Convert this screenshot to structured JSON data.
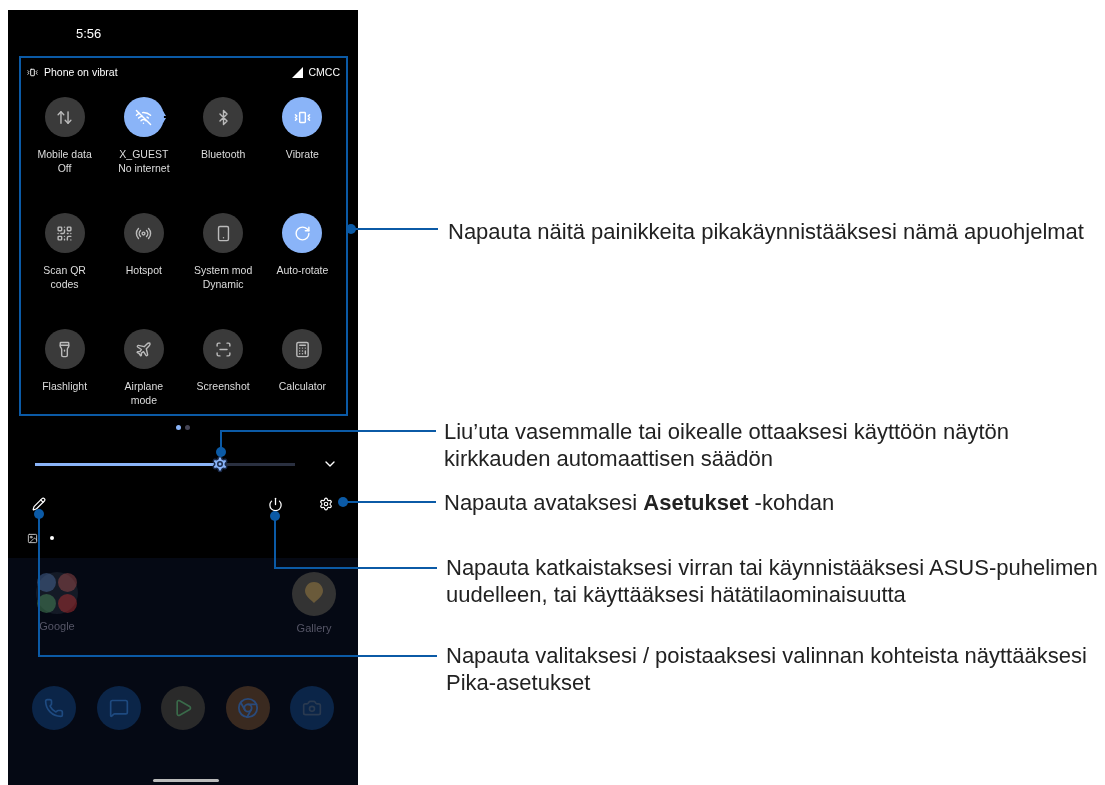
{
  "status_bar": {
    "time": "5:56"
  },
  "quick_settings": {
    "ringer_status": "Phone on vibrat",
    "carrier": "CMCC",
    "tiles": [
      {
        "label": "Mobile data",
        "sublabel": "Off",
        "on": false
      },
      {
        "label": "X_GUEST",
        "sublabel": "No internet",
        "on": true
      },
      {
        "label": "Bluetooth",
        "on": false
      },
      {
        "label": "Vibrate",
        "on": true
      },
      {
        "label": "Scan QR",
        "sublabel": "codes",
        "on": false
      },
      {
        "label": "Hotspot",
        "on": false
      },
      {
        "label": "System mod",
        "sublabel": "Dynamic",
        "on": false
      },
      {
        "label": "Auto-rotate",
        "on": true
      },
      {
        "label": "Flashlight",
        "on": false
      },
      {
        "label": "Airplane",
        "sublabel": "mode",
        "on": false
      },
      {
        "label": "Screenshot",
        "on": false
      },
      {
        "label": "Calculator",
        "on": false
      }
    ],
    "page_dots": [
      {
        "selected": true
      },
      {
        "selected": false
      }
    ],
    "brightness": {
      "level": 0.71
    }
  },
  "home_screen": {
    "apps": [
      {
        "label": "Google"
      },
      {
        "label": "Gallery"
      }
    ]
  },
  "callouts": [
    {
      "lines": [
        "Napauta näitä painikkeita pikakäynnistääksesi nämä apuohjelmat"
      ]
    },
    {
      "lines": [
        "Liu’uta vasemmalle tai oikealle ottaaksesi käyttöön näytön",
        "kirkkauden automaattisen säädön"
      ]
    },
    {
      "lines": [
        "Napauta avataksesi **Asetukset** -kohdan"
      ]
    },
    {
      "lines": [
        "Napauta katkaistaksesi virran tai käynnistääksesi ASUS-puhelimen",
        "uudelleen, tai käyttääksesi hätätilaominaisuutta"
      ]
    },
    {
      "lines": [
        "Napauta valitaksesi / poistaaksesi valinnan kohteista näyttääksesi",
        "Pika-asetukset"
      ]
    }
  ]
}
